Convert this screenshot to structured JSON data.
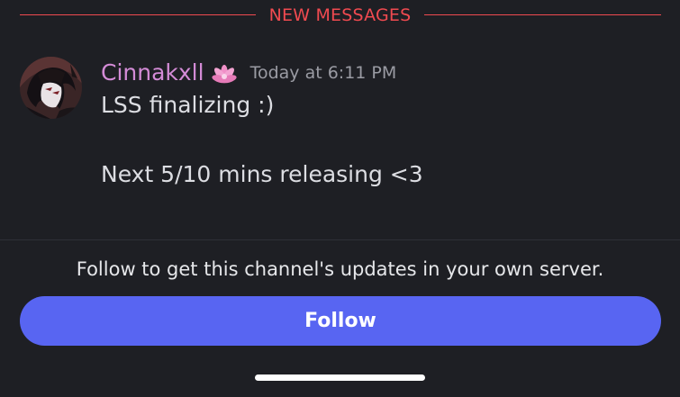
{
  "divider": {
    "label": "NEW MESSAGES",
    "color": "#f04a50"
  },
  "message": {
    "author": {
      "name": "Cinnakxll",
      "name_color": "#d38bd6",
      "role_icon": "lotus-flower-icon"
    },
    "timestamp": "Today at 6:11 PM",
    "lines": [
      "LSS finalizing :)",
      "Next 5/10 mins releasing <3"
    ]
  },
  "follow": {
    "prompt": "Follow to get this channel's updates in your own server.",
    "button_label": "Follow",
    "button_color": "#5865f2"
  },
  "colors": {
    "background": "#1e1f24",
    "text": "#dcdde2",
    "muted": "#9a9ba3"
  }
}
